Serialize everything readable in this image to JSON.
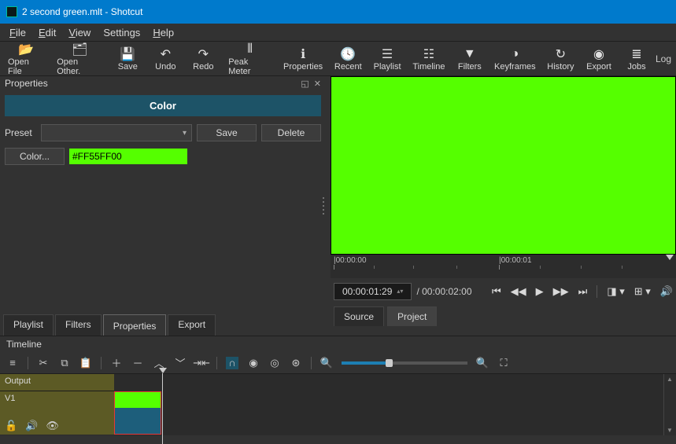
{
  "window": {
    "title": "2 second green.mlt - Shotcut"
  },
  "menu": {
    "file": "File",
    "edit": "Edit",
    "view": "View",
    "settings": "Settings",
    "help": "Help"
  },
  "toolbar": {
    "open_file": "Open File",
    "open_other": "Open Other.",
    "save": "Save",
    "undo": "Undo",
    "redo": "Redo",
    "peak_meter": "Peak Meter",
    "properties": "Properties",
    "recent": "Recent",
    "playlist": "Playlist",
    "timeline": "Timeline",
    "filters": "Filters",
    "keyframes": "Keyframes",
    "history": "History",
    "export": "Export",
    "jobs": "Jobs",
    "log": "Log"
  },
  "properties_panel": {
    "title": "Properties",
    "clip_type_label": "Color",
    "preset_label": "Preset",
    "preset_value": "",
    "save_btn": "Save",
    "delete_btn": "Delete",
    "color_btn": "Color...",
    "color_value": "#FF55FF00",
    "color_swatch": "#55ff00"
  },
  "panel_tabs": {
    "playlist": "Playlist",
    "filters": "Filters",
    "properties": "Properties",
    "export": "Export"
  },
  "preview": {
    "ruler_marks": [
      "00:00:00",
      "00:00:01"
    ],
    "timecode": "00:00:01:29",
    "duration": "00:00:02:00",
    "source_tab": "Source",
    "project_tab": "Project"
  },
  "timeline": {
    "title": "Timeline",
    "output_label": "Output",
    "track_label": "V1"
  }
}
